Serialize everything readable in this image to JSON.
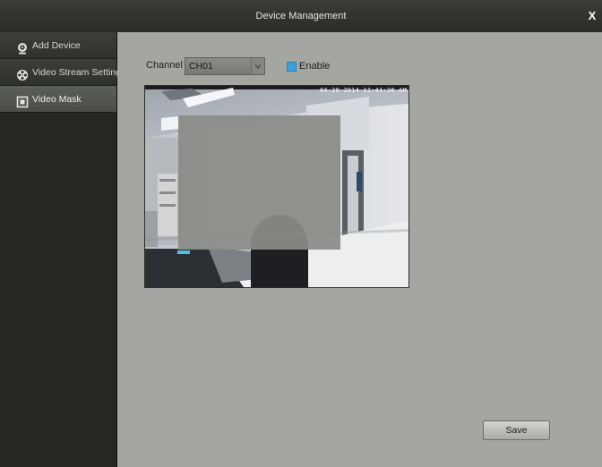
{
  "window": {
    "title": "Device Management",
    "close_label": "X"
  },
  "sidebar": {
    "items": [
      {
        "label": "Add Device",
        "icon": "webcam-icon",
        "active": false
      },
      {
        "label": "Video Stream Settings",
        "icon": "film-reel-icon",
        "active": false
      },
      {
        "label": "Video Mask",
        "icon": "mask-square-icon",
        "active": true
      }
    ]
  },
  "main": {
    "channel_label": "Channel",
    "channel_value": "CH01",
    "enable_label": "Enable",
    "enable_checked": true,
    "video_timestamp": "04-28-2014 11:41:36 AM",
    "save_label": "Save"
  },
  "colors": {
    "sidebar_bg": "#252822",
    "main_bg": "#a3a6a1",
    "checkbox_accent": "#3aa3de",
    "mask_fill": "#8a8c86"
  }
}
